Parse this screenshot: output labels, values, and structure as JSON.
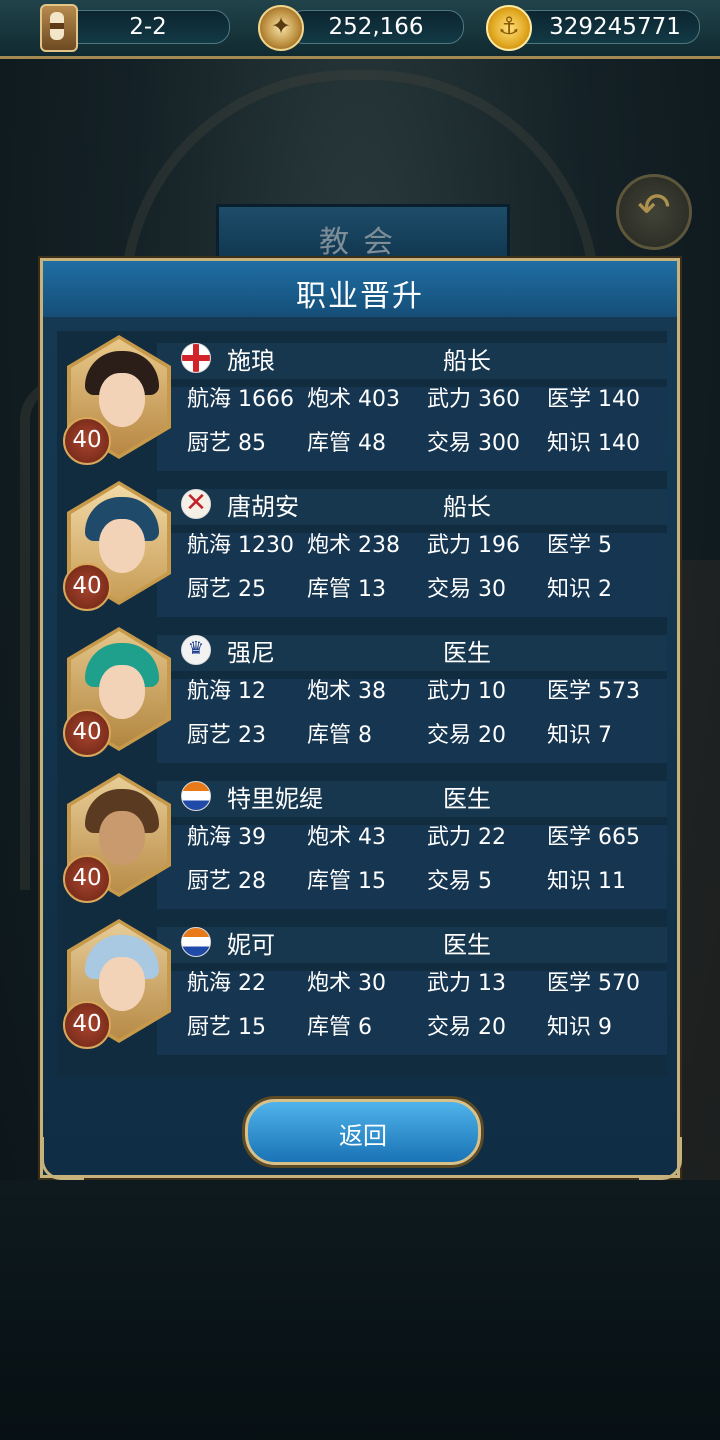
{
  "topbar": {
    "stage": "2-2",
    "compass_value": "252,166",
    "gold_value": "329245771",
    "icons": [
      "hourglass-icon",
      "compass-icon",
      "anchor-coin-icon"
    ]
  },
  "church_title": "教会",
  "dialog": {
    "title": "职业晋升",
    "return_label": "返回"
  },
  "officers": [
    {
      "name": "施琅",
      "job": "船长",
      "level": "40",
      "flag": "england",
      "stats": {
        "navigation": "航海 1666",
        "gunnery": "炮术 403",
        "combat": "武力 360",
        "medicine": "医学 140",
        "cooking": "厨艺 85",
        "storage": "库管 48",
        "trade": "交易 300",
        "knowledge": "知识 140"
      }
    },
    {
      "name": "唐胡安",
      "job": "船长",
      "level": "40",
      "flag": "burgundy",
      "stats": {
        "navigation": "航海 1230",
        "gunnery": "炮术 238",
        "combat": "武力 196",
        "medicine": "医学 5",
        "cooking": "厨艺 25",
        "storage": "库管 13",
        "trade": "交易 30",
        "knowledge": "知识 2"
      }
    },
    {
      "name": "强尼",
      "job": "医生",
      "level": "40",
      "flag": "portugal",
      "stats": {
        "navigation": "航海 12",
        "gunnery": "炮术 38",
        "combat": "武力 10",
        "medicine": "医学 573",
        "cooking": "厨艺 23",
        "storage": "库管 8",
        "trade": "交易 20",
        "knowledge": "知识 7"
      }
    },
    {
      "name": "特里妮缇",
      "job": "医生",
      "level": "40",
      "flag": "netherlands",
      "stats": {
        "navigation": "航海 39",
        "gunnery": "炮术 43",
        "combat": "武力 22",
        "medicine": "医学 665",
        "cooking": "厨艺 28",
        "storage": "库管 15",
        "trade": "交易 5",
        "knowledge": "知识 11"
      }
    },
    {
      "name": "妮可",
      "job": "医生",
      "level": "40",
      "flag": "netherlands",
      "stats": {
        "navigation": "航海 22",
        "gunnery": "炮术 30",
        "combat": "武力 13",
        "medicine": "医学 570",
        "cooking": "厨艺 15",
        "storage": "库管 6",
        "trade": "交易 20",
        "knowledge": "知识 9"
      }
    }
  ],
  "colors": {
    "panel": "#163a54",
    "title_bar": "#1f6ea3",
    "gold_border": "#c8b27c",
    "level_badge": "#8a3420"
  }
}
